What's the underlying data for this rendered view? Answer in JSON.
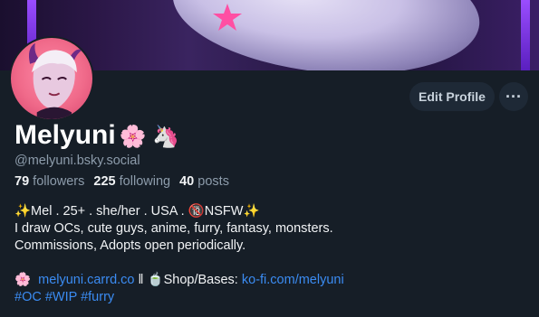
{
  "profile": {
    "display_name": "Melyuni",
    "name_emojis": "🌸 🦄",
    "handle": "@melyuni.bsky.social",
    "followers_count": "79",
    "followers_label": "followers",
    "following_count": "225",
    "following_label": "following",
    "posts_count": "40",
    "posts_label": "posts"
  },
  "actions": {
    "edit_profile_label": "Edit Profile",
    "more_label": "···"
  },
  "bio": {
    "line1": "✨Mel . 25+ . she/her . USA . 🔞NSFW✨",
    "line2": "I draw OCs, cute guys, anime, furry, fantasy, monsters.",
    "line3": "Commissions, Adopts open periodically.",
    "link1_prefix": "🌸",
    "link1": "melyuni.carrd.co",
    "separator": "‖",
    "shop_prefix": "🍵Shop/Bases:",
    "link2": "ko-fi.com/melyuni",
    "hashtags": [
      "#OC",
      "#WIP",
      "#furry"
    ]
  },
  "colors": {
    "background": "#161e27",
    "link": "#3b8cf3",
    "muted": "#8d9cab",
    "button_bg": "#1e2936"
  },
  "icons": {
    "more": "ellipsis-icon",
    "banner_star": "star-icon"
  }
}
